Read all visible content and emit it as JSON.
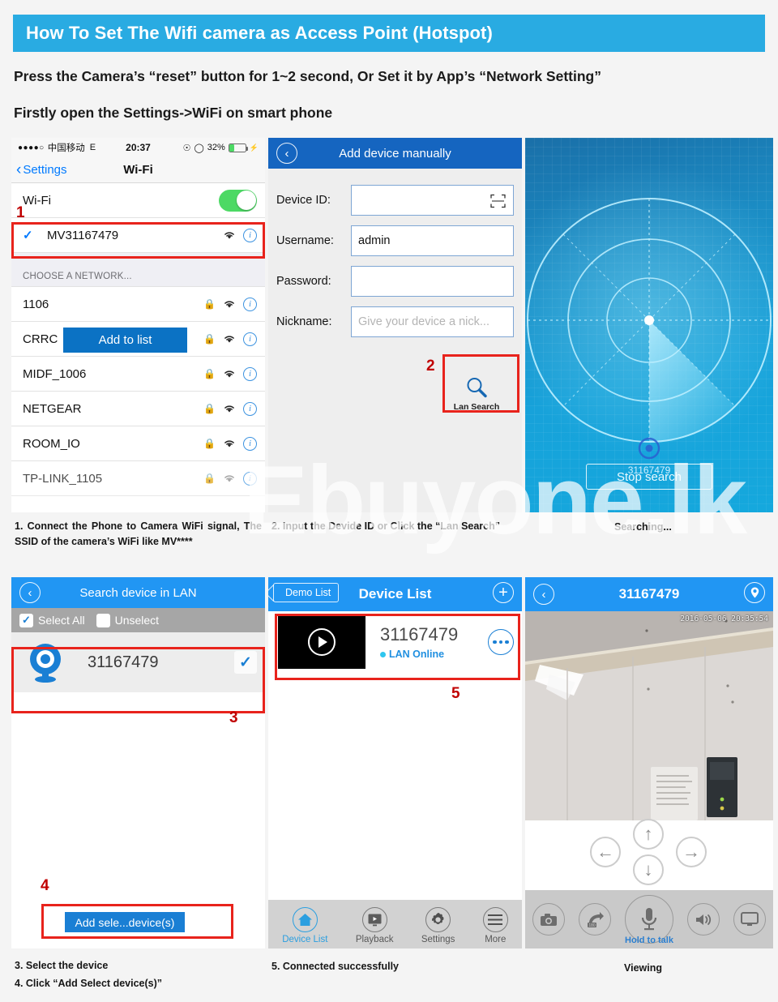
{
  "header": {
    "title": "How To Set The Wifi camera as Access Point (Hotspot)",
    "line1": "Press the Camera’s “reset” button for 1~2 second, Or Set it by App’s “Network Setting”",
    "line2": "Firstly open the Settings->WiFi on smart phone",
    "accent_color": "#29ABE2"
  },
  "watermark": {
    "text": "Ebuyone.lk"
  },
  "panel_wifi": {
    "status_bar": {
      "signal_dots": "●●●●○",
      "carrier": "中国移动",
      "network_type": "E",
      "time": "20:37",
      "battery_percent": "32%",
      "battery_level": 32
    },
    "nav": {
      "back_label": "Settings",
      "title": "Wi-Fi"
    },
    "wifi_toggle": {
      "label": "Wi-Fi",
      "state": "on"
    },
    "connected_network": {
      "ssid": "MV31167479",
      "checked": true
    },
    "section_header": "CHOOSE A NETWORK...",
    "networks": [
      {
        "ssid": "1106",
        "secured": true
      },
      {
        "ssid": "CRRC",
        "secured": true
      },
      {
        "ssid": "MIDF_1006",
        "secured": true
      },
      {
        "ssid": "NETGEAR",
        "secured": true
      },
      {
        "ssid": "ROOM_IO",
        "secured": true
      },
      {
        "ssid": "TP-LINK_1105",
        "secured": true
      }
    ],
    "step_number": "1",
    "caption": "1. Connect the Phone to Camera WiFi signal, The SSID of the camera’s WiFi like MV****"
  },
  "panel_add_device": {
    "nav_title": "Add device manually",
    "fields": [
      {
        "label": "Device ID:",
        "value": "",
        "placeholder": "",
        "has_qr": true
      },
      {
        "label": "Username:",
        "value": "admin",
        "placeholder": "",
        "has_qr": false
      },
      {
        "label": "Password:",
        "value": "",
        "placeholder": "",
        "has_qr": false
      },
      {
        "label": "Nickname:",
        "value": "",
        "placeholder": "Give your device a nick...",
        "has_qr": false
      }
    ],
    "lan_search_label": "Lan Search",
    "add_to_list_label": "Add to list",
    "step_number": "2",
    "caption": "2. Input the Devide ID or Click the “Lan Search”"
  },
  "panel_radar": {
    "device_id": "31167479",
    "stop_label": "Stop search",
    "caption": "Searching..."
  },
  "panel_lan": {
    "nav_title": "Search device in LAN",
    "select_all_label": "Select All",
    "unselect_label": "Unselect",
    "device": {
      "id": "31167479",
      "selected": true
    },
    "add_selected_label": "Add sele...device(s)",
    "step_number_select": "3",
    "step_number_add": "4",
    "caption_line1": "3. Select the device",
    "caption_line2": "4. Click “Add Select device(s)”"
  },
  "panel_device_list": {
    "back_label": "Demo List",
    "nav_title": "Device List",
    "add_icon": "plus-icon",
    "device": {
      "id": "31167479",
      "status": "LAN Online"
    },
    "tabs": [
      {
        "label": "Device List",
        "icon": "home-icon",
        "active": true
      },
      {
        "label": "Playback",
        "icon": "playback-icon",
        "active": false
      },
      {
        "label": "Settings",
        "icon": "gear-icon",
        "active": false
      },
      {
        "label": "More",
        "icon": "hamburger-icon",
        "active": false
      }
    ],
    "step_number": "5",
    "caption": "5. Connected successfully"
  },
  "panel_viewing": {
    "nav_title": "31167479",
    "location_icon": "location-pin-icon",
    "video_timestamp": "2016-05-06  20:35:54",
    "dpad": [
      "up-arrow-icon",
      "down-arrow-icon",
      "left-arrow-icon",
      "right-arrow-icon"
    ],
    "controls": [
      {
        "icon": "camera-icon",
        "label": ""
      },
      {
        "icon": "record-180-icon",
        "label": ""
      },
      {
        "icon": "microphone-icon",
        "label": "Hold to talk"
      },
      {
        "icon": "speaker-icon",
        "label": ""
      },
      {
        "icon": "monitor-icon",
        "label": ""
      }
    ],
    "talk_label": "Hold to talk",
    "caption": "Viewing"
  }
}
